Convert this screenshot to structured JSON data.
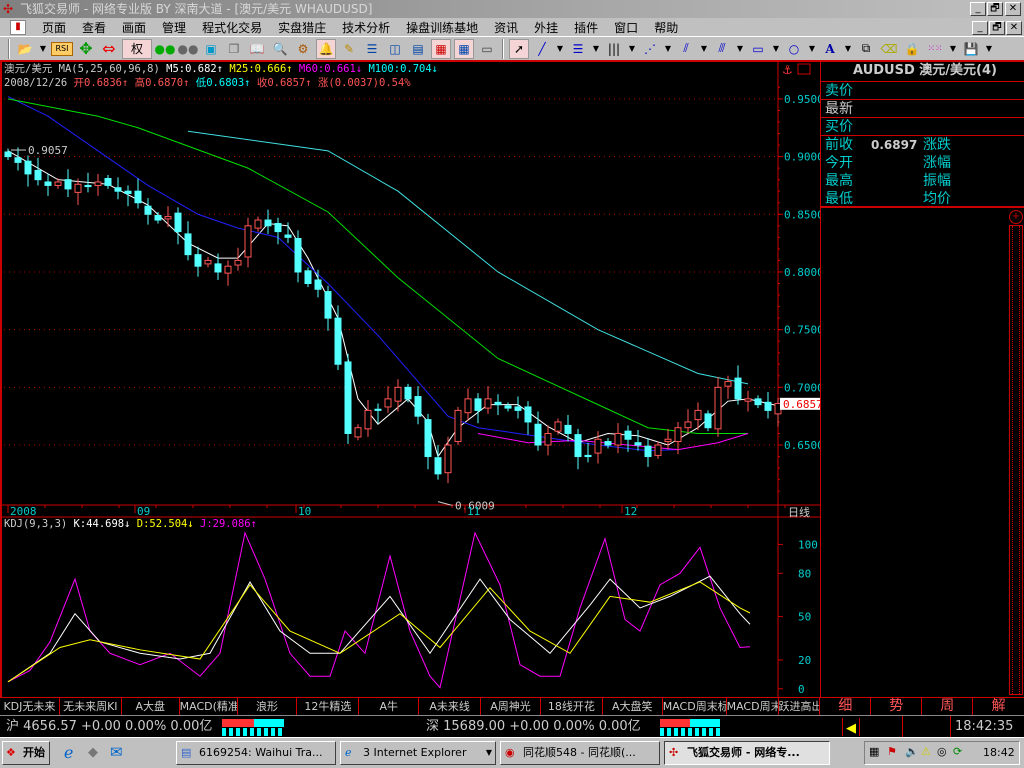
{
  "window": {
    "title": "飞狐交易师 - 网络专业版 BY 深南大道 - [澳元/美元 WHAUDUSD]",
    "min": "_",
    "restore": "🗗",
    "close": "✕"
  },
  "menu": [
    "页面",
    "查看",
    "画面",
    "管理",
    "程式化交易",
    "实盘猎庄",
    "技术分析",
    "操盘训练基地",
    "资讯",
    "外挂",
    "插件",
    "窗口",
    "帮助"
  ],
  "toolbar": {
    "rsi_label": "RSI",
    "quan_label": "权"
  },
  "chart_header": {
    "name": "澳元/美元",
    "ma_params": "MA(5,25,60,96,8)",
    "m5": "M5:0.682↑",
    "m25": "M25:0.666↑",
    "m60": "M60:0.661↓",
    "m100": "M100:0.704↓",
    "date": "2008/12/26",
    "open": "开0.6836↑",
    "high": "高0.6870↑",
    "low": "低0.6803↑",
    "close": "收0.6857↑",
    "change": "涨(0.0037)0.54%"
  },
  "kdj_header": {
    "name": "KDJ(9,3,3)",
    "k": "K:44.698↓",
    "d": "D:52.504↓",
    "j": "J:29.086↑"
  },
  "chart_data": {
    "type": "candlestick",
    "price_axis": {
      "ticks": [
        "0.9500",
        "0.9000",
        "0.8500",
        "0.8000",
        "0.7500",
        "0.7000",
        "0.6500"
      ],
      "tick_values": [
        0.95,
        0.9,
        0.85,
        0.8,
        0.75,
        0.7,
        0.65
      ],
      "range": [
        0.598,
        0.982
      ]
    },
    "current_price": "0.6857",
    "high_label": "0.9057",
    "low_label": "0.6009",
    "high_value": 0.9057,
    "low_value": 0.6009,
    "high_bar": 0,
    "low_bar": 43,
    "period_label": "日线",
    "months": [
      {
        "label": "2008",
        "bar": 0
      },
      {
        "label": "09",
        "bar": 12.7
      },
      {
        "label": "10",
        "bar": 28.8
      },
      {
        "label": "11",
        "bar": 45.7
      },
      {
        "label": "12",
        "bar": 61.4
      }
    ],
    "closes": [
      0.9,
      0.895,
      0.885,
      0.88,
      0.875,
      0.878,
      0.872,
      0.876,
      0.874,
      0.878,
      0.875,
      0.87,
      0.868,
      0.86,
      0.85,
      0.845,
      0.848,
      0.835,
      0.815,
      0.805,
      0.81,
      0.8,
      0.805,
      0.81,
      0.84,
      0.845,
      0.84,
      0.835,
      0.83,
      0.8,
      0.79,
      0.785,
      0.76,
      0.72,
      0.66,
      0.665,
      0.68,
      0.68,
      0.69,
      0.7,
      0.69,
      0.675,
      0.64,
      0.625,
      0.65,
      0.68,
      0.69,
      0.68,
      0.69,
      0.685,
      0.682,
      0.68,
      0.67,
      0.65,
      0.66,
      0.67,
      0.66,
      0.64,
      0.64,
      0.655,
      0.65,
      0.66,
      0.655,
      0.65,
      0.64,
      0.65,
      0.655,
      0.665,
      0.67,
      0.68,
      0.665,
      0.7,
      0.705,
      0.69,
      0.69,
      0.685,
      0.68,
      0.686
    ],
    "ma_lines": [
      {
        "name": "MA5",
        "color": "#ffffff",
        "points": [
          [
            0,
            0.905
          ],
          [
            5,
            0.88
          ],
          [
            10,
            0.876
          ],
          [
            14,
            0.858
          ],
          [
            18,
            0.825
          ],
          [
            21,
            0.812
          ],
          [
            23,
            0.812
          ],
          [
            26,
            0.842
          ],
          [
            28,
            0.84
          ],
          [
            30,
            0.812
          ],
          [
            33,
            0.76
          ],
          [
            35,
            0.69
          ],
          [
            37,
            0.668
          ],
          [
            40,
            0.69
          ],
          [
            42,
            0.67
          ],
          [
            43,
            0.64
          ],
          [
            45,
            0.665
          ],
          [
            48,
            0.685
          ],
          [
            51,
            0.685
          ],
          [
            54,
            0.666
          ],
          [
            57,
            0.652
          ],
          [
            60,
            0.66
          ],
          [
            63,
            0.658
          ],
          [
            66,
            0.65
          ],
          [
            69,
            0.665
          ],
          [
            72,
            0.688
          ],
          [
            74,
            0.69
          ],
          [
            77,
            0.684
          ]
        ]
      },
      {
        "name": "MA25",
        "color": "#2020ff",
        "points": [
          [
            0,
            0.952
          ],
          [
            4,
            0.935
          ],
          [
            9,
            0.905
          ],
          [
            14,
            0.875
          ],
          [
            19,
            0.85
          ],
          [
            23,
            0.838
          ],
          [
            27,
            0.83
          ],
          [
            32,
            0.79
          ],
          [
            37,
            0.745
          ],
          [
            41,
            0.705
          ],
          [
            44,
            0.675
          ],
          [
            47,
            0.665
          ],
          [
            51,
            0.66
          ],
          [
            55,
            0.655
          ],
          [
            59,
            0.65
          ],
          [
            64,
            0.645
          ],
          [
            67,
            0.646
          ]
        ]
      },
      {
        "name": "MA60",
        "color": "#00e000",
        "points": [
          [
            0,
            0.95
          ],
          [
            9,
            0.935
          ],
          [
            13,
            0.925
          ],
          [
            24,
            0.89
          ],
          [
            32,
            0.852
          ],
          [
            39,
            0.795
          ],
          [
            49,
            0.725
          ],
          [
            59,
            0.685
          ],
          [
            64,
            0.665
          ],
          [
            69,
            0.66
          ],
          [
            74,
            0.66
          ]
        ]
      },
      {
        "name": "MA100",
        "color": "#40e0e0",
        "points": [
          [
            18,
            0.922
          ],
          [
            32,
            0.905
          ],
          [
            39,
            0.87
          ],
          [
            49,
            0.8
          ],
          [
            59,
            0.75
          ],
          [
            69,
            0.712
          ],
          [
            74,
            0.703
          ]
        ]
      },
      {
        "name": "MA96",
        "color": "#ff00ff",
        "points": [
          [
            47,
            0.66
          ],
          [
            52,
            0.652
          ],
          [
            57,
            0.654
          ],
          [
            62,
            0.65
          ],
          [
            67,
            0.646
          ],
          [
            71,
            0.652
          ],
          [
            74,
            0.66
          ]
        ]
      }
    ],
    "kdj": {
      "axis_ticks": [
        "100",
        "80",
        "50",
        "20",
        "0"
      ],
      "tick_values": [
        100,
        80,
        50,
        20,
        0
      ],
      "range": [
        -5,
        110
      ],
      "lines": [
        {
          "name": "J",
          "color": "#ff00ff",
          "points": [
            [
              0,
              4.8
            ],
            [
              2.2,
              12.7
            ],
            [
              4.2,
              32.5
            ],
            [
              6.7,
              76
            ],
            [
              8.2,
              40
            ],
            [
              10.2,
              24.6
            ],
            [
              13.2,
              16.7
            ],
            [
              16.2,
              24.6
            ],
            [
              19.2,
              8.7
            ],
            [
              21.2,
              24.6
            ],
            [
              23.7,
              108
            ],
            [
              25.7,
              76
            ],
            [
              28.2,
              24.6
            ],
            [
              30.2,
              8.7
            ],
            [
              32.2,
              8.7
            ],
            [
              33.7,
              40
            ],
            [
              35.7,
              24.6
            ],
            [
              38.2,
              92
            ],
            [
              40.2,
              40
            ],
            [
              42.2,
              8.7
            ],
            [
              43.2,
              0.8
            ],
            [
              46.7,
              108
            ],
            [
              49.2,
              72
            ],
            [
              51.2,
              16.7
            ],
            [
              53.2,
              8.7
            ],
            [
              55.2,
              8.7
            ],
            [
              57.2,
              56
            ],
            [
              59.7,
              104
            ],
            [
              61.7,
              48
            ],
            [
              63.2,
              40
            ],
            [
              65.2,
              72
            ],
            [
              67.2,
              80
            ],
            [
              69.2,
              98
            ],
            [
              71.2,
              56
            ],
            [
              73.2,
              28.6
            ],
            [
              74.2,
              29.1
            ]
          ]
        },
        {
          "name": "K",
          "color": "#ffffff",
          "points": [
            [
              0,
              4.8
            ],
            [
              4.2,
              24.6
            ],
            [
              6.7,
              52
            ],
            [
              9.2,
              32.5
            ],
            [
              13.2,
              24.6
            ],
            [
              17.2,
              20.6
            ],
            [
              20.2,
              24.6
            ],
            [
              24.2,
              74
            ],
            [
              27.2,
              40
            ],
            [
              30.2,
              24.6
            ],
            [
              33.2,
              24.6
            ],
            [
              38.2,
              64
            ],
            [
              42.2,
              24.6
            ],
            [
              47.2,
              76
            ],
            [
              50.2,
              48
            ],
            [
              54.2,
              24.6
            ],
            [
              58.2,
              58
            ],
            [
              60.2,
              76
            ],
            [
              63.2,
              56
            ],
            [
              66.2,
              64
            ],
            [
              70.2,
              78
            ],
            [
              73.2,
              52
            ],
            [
              74.2,
              44.7
            ]
          ]
        },
        {
          "name": "D",
          "color": "#ffff00",
          "points": [
            [
              0,
              4.8
            ],
            [
              5.2,
              28.6
            ],
            [
              8.2,
              34
            ],
            [
              13.2,
              27
            ],
            [
              19.2,
              20.6
            ],
            [
              24.2,
              72
            ],
            [
              28.2,
              40
            ],
            [
              33.2,
              24.6
            ],
            [
              39.2,
              52
            ],
            [
              43.2,
              28.6
            ],
            [
              48.2,
              70
            ],
            [
              52.2,
              40
            ],
            [
              56.2,
              24.6
            ],
            [
              60.2,
              64
            ],
            [
              64.2,
              60
            ],
            [
              69.2,
              74
            ],
            [
              73.2,
              56
            ],
            [
              74.2,
              52.5
            ]
          ]
        }
      ]
    }
  },
  "info_panel": {
    "title": "AUDUSD 澳元/美元(4)",
    "sell": "卖价",
    "latest": "最新",
    "buy": "买价",
    "prev_close": "前收",
    "prev_close_value": "0.6897",
    "open": "今开",
    "high": "最高",
    "low": "最低",
    "change": "涨跌",
    "change_pct": "涨幅",
    "amplitude": "振幅",
    "avg": "均价"
  },
  "bottom_tabs": [
    "KDJ无未来",
    "无未来周KI",
    "A大盘",
    "MACD(精准",
    "浪形",
    "12牛精选",
    "A牛",
    "A未来线",
    "A周神光",
    "18线开花",
    "A大盘笑",
    "MACD周末标",
    "MACD周末",
    "跃进高出"
  ],
  "right_tabs": [
    "细",
    "势",
    "周",
    "解"
  ],
  "status": {
    "sh": "沪 4656.57 +0.00 0.00% 0.00亿",
    "sz": "深 15689.00 +0.00 0.00% 0.00亿",
    "time": "18:42:35"
  },
  "taskbar": {
    "start": "开始",
    "tasks": [
      "6169254: Waihui Tra...",
      "3 Internet Explorer",
      "同花顺548 - 同花顺(...",
      "飞狐交易师 - 网络专..."
    ],
    "clock": "18:42"
  }
}
